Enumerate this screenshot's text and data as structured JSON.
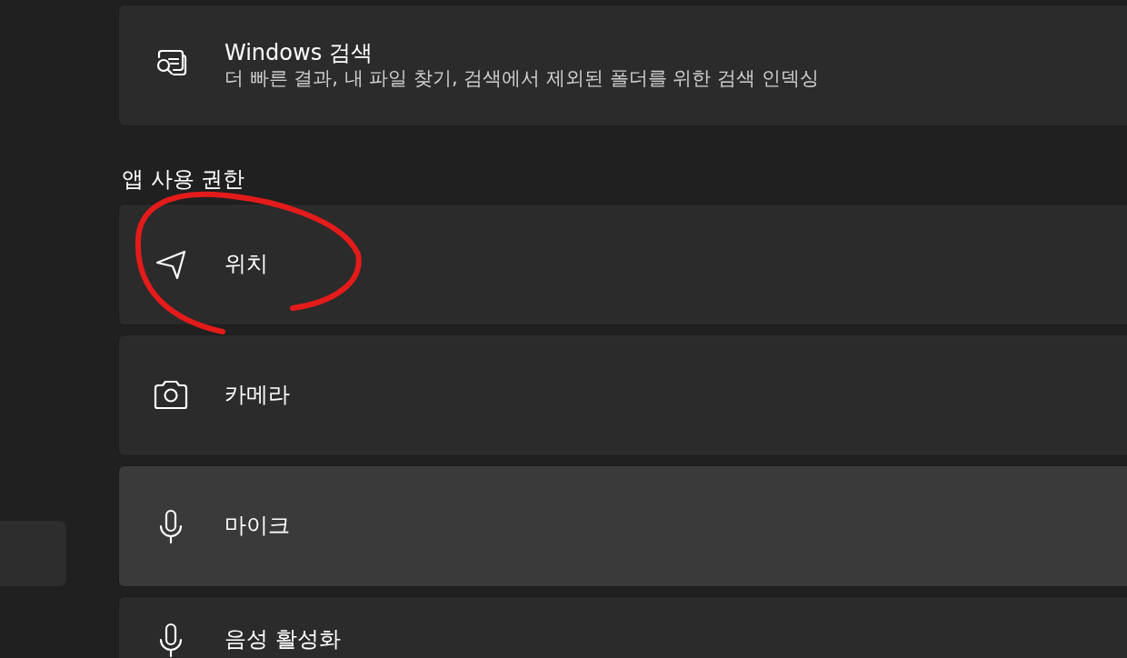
{
  "sidebar": {
    "items": [
      {
        "selected": true
      }
    ]
  },
  "search_card": {
    "title": "Windows 검색",
    "description": "더 빠른 결과, 내 파일 찾기, 검색에서 제외된 폴더를 위한 검색 인덱싱"
  },
  "section": {
    "heading": "앱 사용 권한"
  },
  "permissions": [
    {
      "label": "위치",
      "hovered": false
    },
    {
      "label": "카메라",
      "hovered": false
    },
    {
      "label": "마이크",
      "hovered": true
    },
    {
      "label": "음성 활성화",
      "hovered": false
    }
  ],
  "annotation": {
    "kind": "freehand",
    "color": "#e31b1b"
  }
}
